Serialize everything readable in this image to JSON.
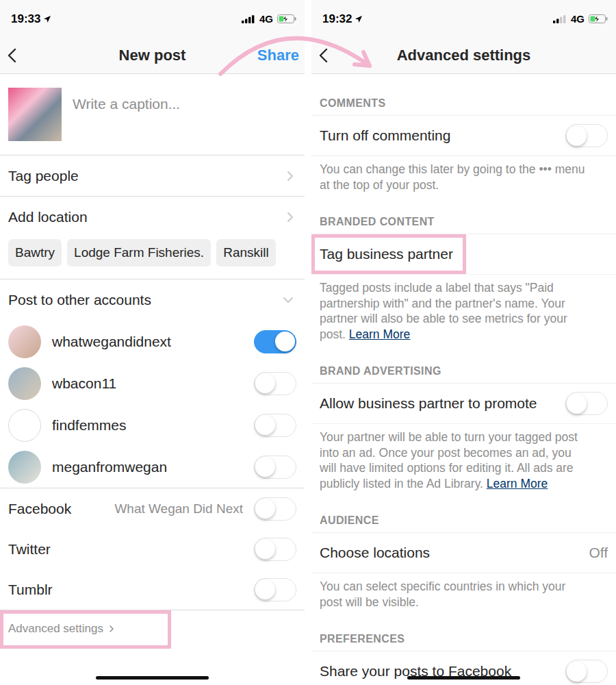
{
  "left": {
    "status": {
      "time": "19:33",
      "network": "4G",
      "signal": 1,
      "battery": 0.35,
      "charging": true
    },
    "nav": {
      "title": "New post",
      "action": "Share"
    },
    "caption": {
      "placeholder": "Write a caption..."
    },
    "links": [
      "Tag people",
      "Add location"
    ],
    "location_suggestions": [
      "Bawtry",
      "Lodge Farm Fisheries.",
      "Ranskill"
    ],
    "accounts_section": {
      "label": "Post to other accounts",
      "expanded": true
    },
    "accounts": [
      {
        "name": "whatwegandidnext",
        "on": true
      },
      {
        "name": "wbacon11",
        "on": false
      },
      {
        "name": "findfemmes",
        "on": false
      },
      {
        "name": "meganfromwegan",
        "on": false
      }
    ],
    "share_targets": [
      {
        "name": "Facebook",
        "account": "What Wegan Did Next",
        "on": false
      },
      {
        "name": "Twitter",
        "on": false
      },
      {
        "name": "Tumblr",
        "on": false
      }
    ],
    "advanced": {
      "label": "Advanced settings",
      "highlighted": true
    }
  },
  "right": {
    "status": {
      "time": "19:32",
      "network": "4G",
      "signal": 0.5,
      "battery": 0.35,
      "charging": true
    },
    "nav": {
      "title": "Advanced settings"
    },
    "sections": [
      {
        "header": "COMMENTS",
        "row": {
          "kind": "toggle",
          "label": "Turn off commenting",
          "on": false,
          "highlighted": false
        },
        "note": "You can change this later by going to the ••• menu at the top of your post."
      },
      {
        "header": "BRANDED CONTENT",
        "row": {
          "kind": "action",
          "label": "Tag business partner",
          "highlighted": true
        },
        "note": "Tagged posts include a label that says \"Paid partnership with\" and the partner's name. Your partner will also be able to see metrics for your post.",
        "link": "Learn More"
      },
      {
        "header": "BRAND ADVERTISING",
        "row": {
          "kind": "toggle",
          "label": "Allow business partner to promote",
          "on": false,
          "highlighted": false
        },
        "note": "Your partner will be able to turn your tagged post into an ad. Once your post becomes an ad, you will have limited options for editing it. All ads are publicly listed in the Ad Library.",
        "link": "Learn More"
      },
      {
        "header": "AUDIENCE",
        "row": {
          "kind": "value",
          "label": "Choose locations",
          "value": "Off",
          "highlighted": false
        },
        "note": "You can select specific countries in which your post will be visible."
      },
      {
        "header": "PREFERENCES",
        "row": {
          "kind": "toggle",
          "label": "Share your posts to Facebook",
          "on": false,
          "highlighted": false
        }
      }
    ]
  }
}
